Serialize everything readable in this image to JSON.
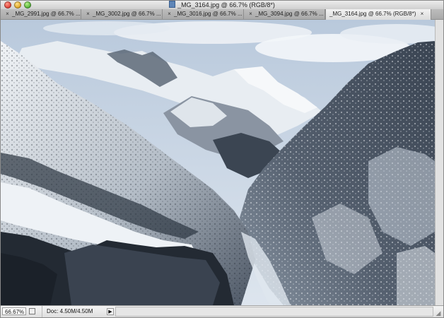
{
  "window": {
    "title": "_MG_3164.jpg @ 66.7% (RGB/8*)"
  },
  "tabs": [
    {
      "label": "_MG_2991.jpg @ 66.7% ...",
      "close": "×"
    },
    {
      "label": "_MG_3002.jpg @ 66.7% ...",
      "close": "×"
    },
    {
      "label": "_MG_3016.jpg @ 66.7% ...",
      "close": "×"
    },
    {
      "label": "_MG_3094.jpg @ 66.7% ...",
      "close": "×"
    },
    {
      "label": "_MG_3164.jpg @ 66.7% (RGB/8*)",
      "close": "×",
      "active": true
    }
  ],
  "status": {
    "zoom": "66.67%",
    "doc_info": "Doc: 4.50M/4.50M",
    "arrow": "▶"
  },
  "colors": {
    "sky": "#cdd9e8",
    "snow": "#eef2f6",
    "rock_dark": "#1c232c",
    "rock_mid": "#3e4857"
  },
  "icons": {
    "close": "close-icon",
    "window_close": "window-close-icon",
    "window_minimize": "window-minimize-icon",
    "window_zoom": "window-zoom-icon",
    "document": "document-icon",
    "status_menu": "status-menu-arrow-icon",
    "resize": "resize-grip-icon"
  }
}
